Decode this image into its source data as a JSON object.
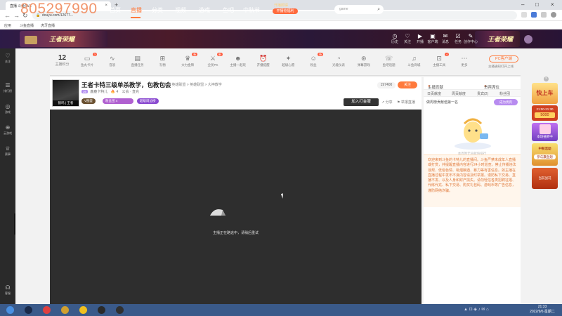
{
  "overlay": {
    "number": "805297990"
  },
  "browser": {
    "tab_title": "直播 斗鱼TV...",
    "url": "douyu.com/12677...",
    "bookmarks": [
      "应用",
      "斗鱼直播",
      "虎牙直播",
      "...."
    ]
  },
  "header": {
    "banner_left_text": "王者荣耀",
    "banner_right_text": "王者荣耀",
    "nav": [
      "首页",
      "直播",
      "分类",
      "视频",
      "游戏",
      "鱼吧",
      "中秋节"
    ],
    "promo_line1": "开播即得",
    "promo_line2": "开播抢福利",
    "search_placeholder": "game",
    "icons": [
      {
        "icon": "history-icon",
        "label": "历史"
      },
      {
        "icon": "follow-icon",
        "label": "关注"
      },
      {
        "icon": "broadcast-icon",
        "label": "开播"
      },
      {
        "icon": "client-icon",
        "label": "客户端"
      },
      {
        "icon": "message-icon",
        "label": "消息"
      },
      {
        "icon": "task-icon",
        "label": "任务"
      },
      {
        "icon": "creator-icon",
        "label": "创作中心"
      }
    ]
  },
  "sidebar": {
    "items": [
      {
        "icon": "heart-icon",
        "label": "关注"
      },
      {
        "icon": "list-icon",
        "label": "排行榜"
      },
      {
        "icon": "game-icon",
        "label": "游戏"
      },
      {
        "icon": "gamepad-icon",
        "label": "云游戏"
      },
      {
        "icon": "trophy-icon",
        "label": "赛事"
      },
      {
        "icon": "headset-icon",
        "label": "客服"
      }
    ]
  },
  "toolbar": {
    "level_value": "12",
    "level_label": "主播积分",
    "items": [
      {
        "icon": "fans-card-icon",
        "label": "鱼丸卡片",
        "badge": "3"
      },
      {
        "icon": "wave-icon",
        "label": "音浪"
      },
      {
        "icon": "task-list-icon",
        "label": "直播任务"
      },
      {
        "icon": "gift-box-icon",
        "label": "礼物"
      },
      {
        "icon": "crown-icon",
        "label": "大力金牌",
        "badge": "新"
      },
      {
        "icon": "pk-icon",
        "label": "全民PK",
        "badge": "新"
      },
      {
        "icon": "team-icon",
        "label": "主播一起玩"
      },
      {
        "icon": "alarm-icon",
        "label": "开播提醒"
      },
      {
        "icon": "wish-icon",
        "label": "超级心愿"
      },
      {
        "icon": "fans-icon",
        "label": "粉丝",
        "badge": "新"
      },
      {
        "icon": "dashboard-icon",
        "label": "光能仪表"
      },
      {
        "icon": "gamepad2-icon",
        "label": "弹幕游戏"
      },
      {
        "icon": "chat-icon",
        "label": "鱼吧话题"
      },
      {
        "icon": "mic-icon",
        "label": "斗鱼商城"
      },
      {
        "icon": "bag-icon",
        "label": "主播工具",
        "badge": "4"
      },
      {
        "icon": "more-icon",
        "label": "更多"
      }
    ],
    "pc_button": "PC客户端",
    "pc_sub": "主播通知打开上线"
  },
  "room": {
    "avatar_caption": "鹤鸣 | 王者",
    "title": "王者卡特三级单杀教学，包教包会",
    "meta": "举报  英雄联盟 > 英雄联盟 > 大神教学",
    "level_tag": "36",
    "streamer": "鹿鹿卡特儿",
    "hot": "4",
    "extra": "公会 · 直充",
    "pill_vip": "V图鉴",
    "pill_fans": "粉丝团",
    "pill_fans_num": "4",
    "pill_game": "超级周边榜",
    "viewers": "197400",
    "follow": "关注",
    "live_btn": "加入打金服",
    "share": "分享",
    "report": "举报直播"
  },
  "player": {
    "message": "主播正在路途中，请稍后重试"
  },
  "right_panel": {
    "head_left": "主播贡献",
    "head_right": "贵宾席位",
    "tabs": [
      "日贡献度",
      "周贡献度",
      "贵宾(2)",
      "粉丝团"
    ],
    "rank_text": "做周榜贡献值第一名",
    "rank_button": "成为贵宾",
    "empty_caption": "本周暂无贡献值排行",
    "notice": "欢迎来到斗鱼的卡特儿的直播间。斗鱼严禁未成年人直播或打赏，并提醒直播内容进行24小时巡查。禁止传播违法违规、低俗色情、吸烟酗酒、暴力等有害信息。如主播在直播过程中发布不良内容请及时举报。谨防私下交易、直播不发、以及人身和财产损失。请勿轻信各类招聘征婚、代练代充、私下交易、购买礼包码、游戏币等广告信息，谨防网络诈骗。"
  },
  "gift_strip": {
    "card1_top": "快上车",
    "card1_time": "21:00-21:30",
    "card1_num": "5000",
    "card2": "本场抽奖中",
    "card3": "中秋活动",
    "card3_sub": "参与赢鱼翅",
    "card4": "当前战况"
  },
  "taskbar": {
    "apps": [
      "windows-start-icon",
      "media-icon",
      "red-app-icon",
      "game-app-icon",
      "chrome-icon",
      "lol-icon",
      "obs-icon"
    ],
    "time": "21:33",
    "date": "2022/9/6 星期二"
  }
}
